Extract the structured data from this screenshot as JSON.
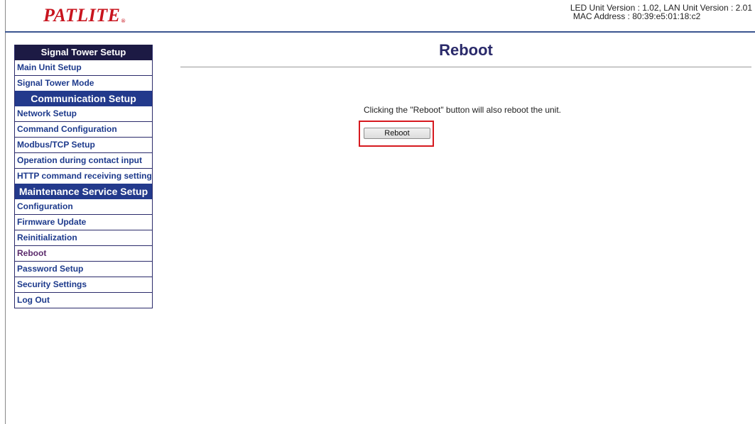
{
  "header": {
    "logo": "PATLITE",
    "logo_mark": "®",
    "version_line1": "LED Unit Version : 1.02, LAN Unit Version : 2.01",
    "version_line2": "MAC Address : 80:39:e5:01:18:c2"
  },
  "sidebar": {
    "sections": [
      {
        "title": "Signal Tower Setup",
        "items": [
          "Main Unit Setup",
          "Signal Tower Mode"
        ]
      },
      {
        "title": "Communication Setup",
        "items": [
          "Network Setup",
          "Command Configuration",
          "Modbus/TCP Setup",
          "Operation during contact input",
          "HTTP command receiving settings"
        ]
      },
      {
        "title": "Maintenance Service Setup",
        "items": [
          "Configuration",
          "Firmware Update",
          "Reinitialization",
          "Reboot",
          "Password Setup",
          "Security Settings",
          "Log Out"
        ]
      }
    ],
    "active_item": "Reboot"
  },
  "main": {
    "title": "Reboot",
    "notice": "Clicking the \"Reboot\" button will also reboot the unit.",
    "reboot_button": "Reboot"
  },
  "colors": {
    "brand_red": "#c8141e",
    "nav_dark": "#1c1a44",
    "nav_blue": "#233a8c",
    "link_blue": "#1d3a8c",
    "highlight_red": "#d6191f"
  }
}
